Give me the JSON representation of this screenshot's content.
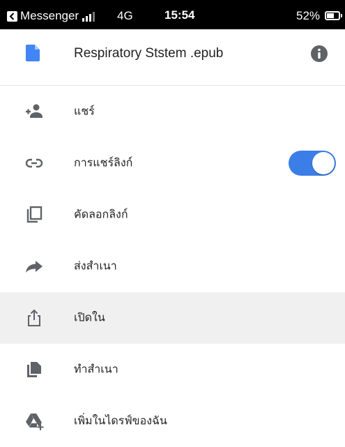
{
  "status_bar": {
    "app": "Messenger",
    "network": "4G",
    "time": "15:54",
    "battery": "52%"
  },
  "header": {
    "title": "Respiratory Ststem .epub",
    "file_icon": "document-icon",
    "info_icon": "info-icon",
    "accent_color": "#4285f4"
  },
  "menu": [
    {
      "label": "แชร์",
      "icon": "add-person-icon"
    },
    {
      "label": "การแชร์ลิงก์",
      "icon": "link-icon",
      "toggle_on": true
    },
    {
      "label": "คัดลอกลิงก์",
      "icon": "copy-icon"
    },
    {
      "label": "ส่งสำเนา",
      "icon": "forward-arrow-icon"
    },
    {
      "label": "เปิดใน",
      "icon": "share-up-icon",
      "highlighted": true
    },
    {
      "label": "ทำสำเนา",
      "icon": "duplicate-icon"
    },
    {
      "label": "เพิ่มในไดรฟ์ของฉัน",
      "icon": "add-to-drive-icon"
    }
  ],
  "colors": {
    "toggle_on": "#3b7ee8",
    "icon_gray": "#5f6368",
    "highlight_bg": "#f0f0f0"
  }
}
